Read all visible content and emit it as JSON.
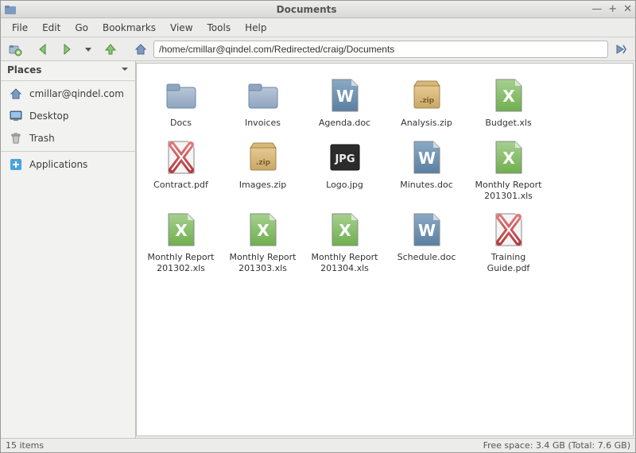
{
  "window": {
    "title": "Documents"
  },
  "menu": {
    "items": [
      "File",
      "Edit",
      "Go",
      "Bookmarks",
      "View",
      "Tools",
      "Help"
    ]
  },
  "toolbar": {
    "path": "/home/cmillar@qindel.com/Redirected/craig/Documents"
  },
  "sidebar": {
    "header": "Places",
    "items": [
      {
        "label": "cmillar@qindel.com",
        "icon": "home"
      },
      {
        "label": "Desktop",
        "icon": "desktop"
      },
      {
        "label": "Trash",
        "icon": "trash"
      },
      {
        "label": "Applications",
        "icon": "apps"
      }
    ]
  },
  "files": [
    {
      "label": "Docs",
      "type": "folder"
    },
    {
      "label": "Invoices",
      "type": "folder"
    },
    {
      "label": "Agenda.doc",
      "type": "doc"
    },
    {
      "label": "Analysis.zip",
      "type": "zip"
    },
    {
      "label": "Budget.xls",
      "type": "xls"
    },
    {
      "label": "Contract.pdf",
      "type": "pdf"
    },
    {
      "label": "Images.zip",
      "type": "zip"
    },
    {
      "label": "Logo.jpg",
      "type": "jpg"
    },
    {
      "label": "Minutes.doc",
      "type": "doc"
    },
    {
      "label": "Monthly Report 201301.xls",
      "type": "xls"
    },
    {
      "label": "Monthly Report 201302.xls",
      "type": "xls"
    },
    {
      "label": "Monthly Report 201303.xls",
      "type": "xls"
    },
    {
      "label": "Monthly Report 201304.xls",
      "type": "xls"
    },
    {
      "label": "Schedule.doc",
      "type": "doc"
    },
    {
      "label": "Training Guide.pdf",
      "type": "pdf"
    }
  ],
  "status": {
    "left": "15 items",
    "right": "Free space: 3.4 GB (Total: 7.6 GB)"
  }
}
